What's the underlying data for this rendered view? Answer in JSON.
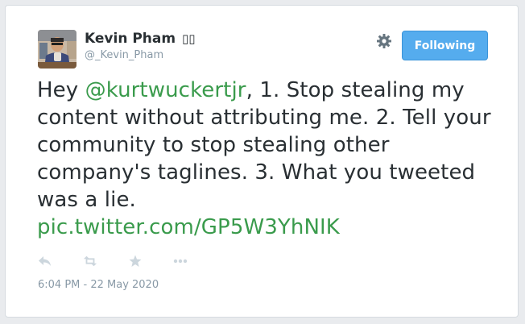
{
  "author": {
    "display_name": "Kevin Pham",
    "name_emoji": "▯▯",
    "username": "@_Kevin_Pham"
  },
  "follow_button": {
    "label": "Following"
  },
  "tweet": {
    "prefix": "Hey ",
    "mention": "@kurtwuckertjr",
    "body": ", 1. Stop stealing my content without attributing me. 2. Tell your community to stop stealing other company's taglines. 3. What you tweeted was a lie.",
    "link": "pic.twitter.com/GP5W3YhNIK",
    "timestamp": "6:04 PM - 22 May 2020"
  },
  "icons": {
    "settings": "gear-icon",
    "reply": "reply-icon",
    "retweet": "retweet-icon",
    "favorite": "star-icon",
    "more": "more-icon"
  },
  "colors": {
    "link": "#3a9b4c",
    "button": "#55acee",
    "text": "#292f33",
    "muted": "#8899a6"
  }
}
